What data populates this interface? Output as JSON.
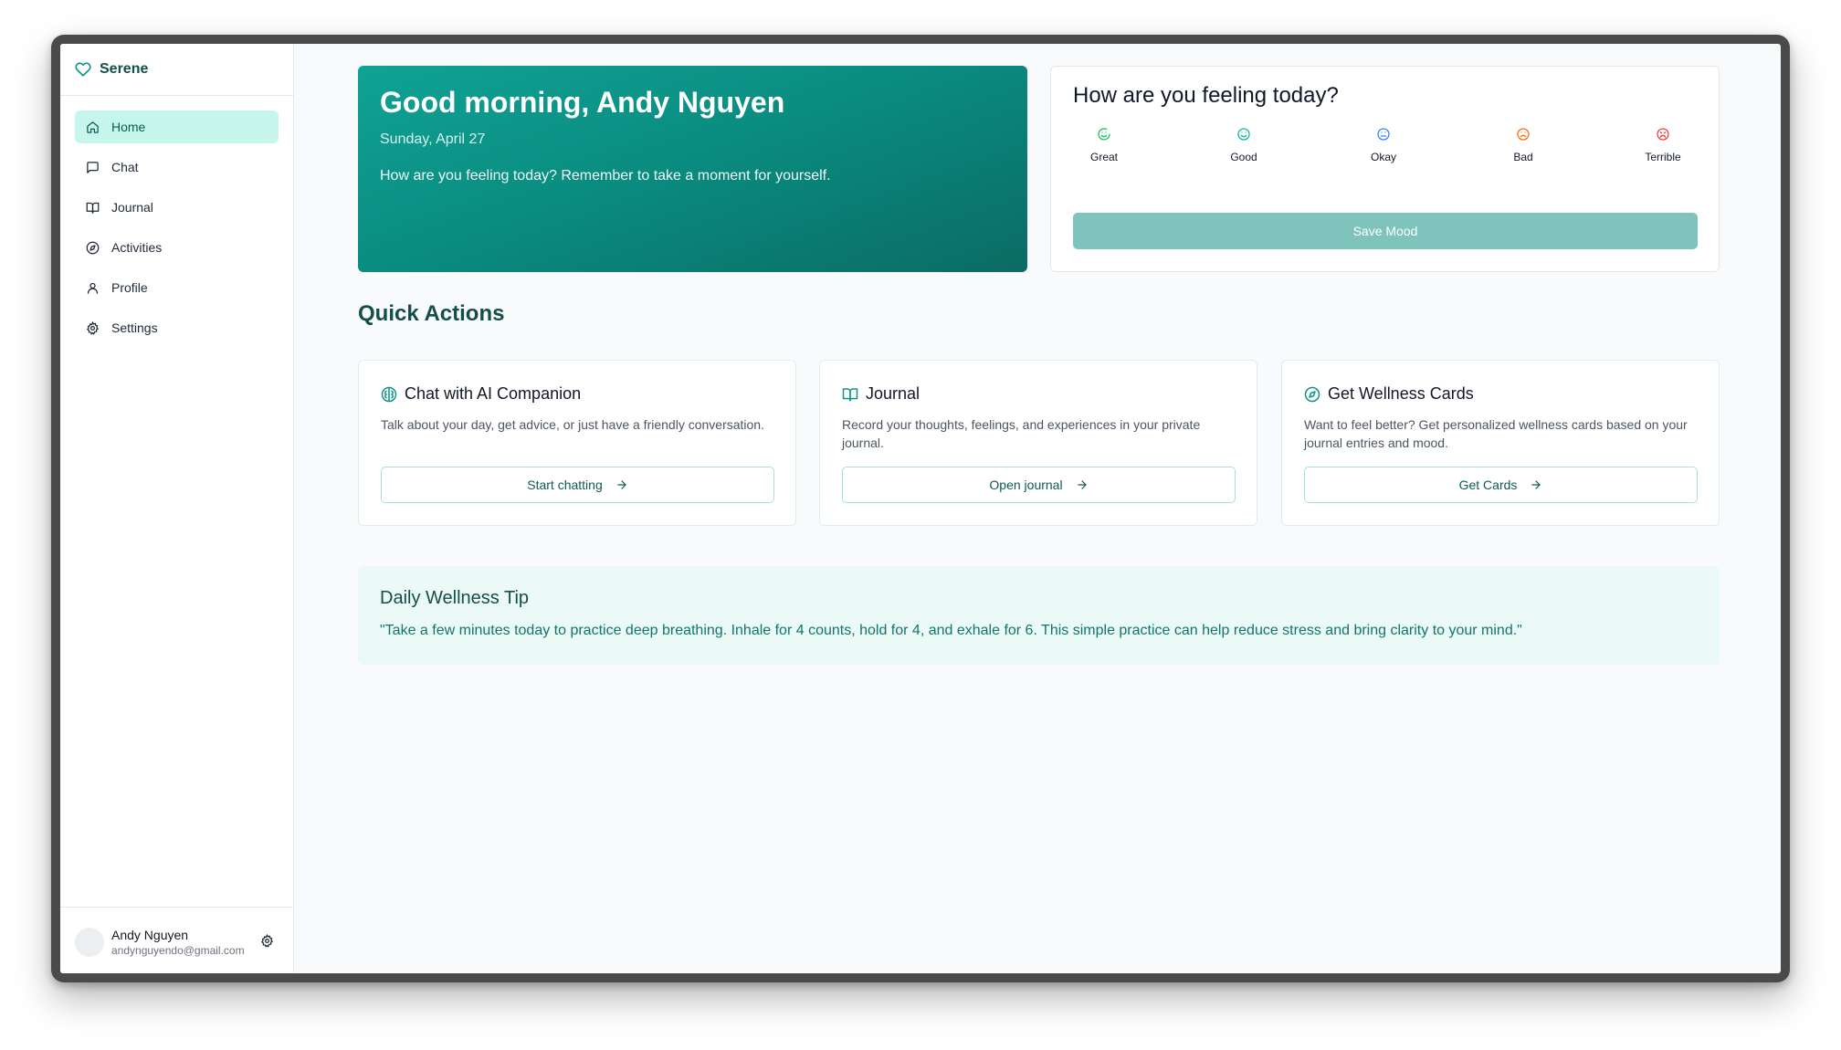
{
  "app": {
    "name": "Serene"
  },
  "sidebar": {
    "items": [
      {
        "label": "Home",
        "icon": "home-icon",
        "active": true
      },
      {
        "label": "Chat",
        "icon": "chat-icon",
        "active": false
      },
      {
        "label": "Journal",
        "icon": "book-icon",
        "active": false
      },
      {
        "label": "Activities",
        "icon": "compass-icon",
        "active": false
      },
      {
        "label": "Profile",
        "icon": "user-icon",
        "active": false
      },
      {
        "label": "Settings",
        "icon": "gear-icon",
        "active": false
      }
    ],
    "user": {
      "name": "Andy Nguyen",
      "email": "andynguyendo@gmail.com"
    }
  },
  "hero": {
    "greeting": "Good morning, Andy Nguyen",
    "date": "Sunday, April 27",
    "message": "How are you feeling today? Remember to take a moment for yourself."
  },
  "mood": {
    "title": "How are you feeling today?",
    "options": [
      {
        "label": "Great",
        "color": "#22c55e"
      },
      {
        "label": "Good",
        "color": "#14b8a6"
      },
      {
        "label": "Okay",
        "color": "#3b82f6"
      },
      {
        "label": "Bad",
        "color": "#f97316"
      },
      {
        "label": "Terrible",
        "color": "#ef4444"
      }
    ],
    "save_label": "Save Mood"
  },
  "quick_actions": {
    "title": "Quick Actions",
    "cards": [
      {
        "title": "Chat with AI Companion",
        "description": "Talk about your day, get advice, or just have a friendly conversation.",
        "button": "Start chatting",
        "icon": "brain-icon"
      },
      {
        "title": "Journal",
        "description": "Record your thoughts, feelings, and experiences in your private journal.",
        "button": "Open journal",
        "icon": "book-icon"
      },
      {
        "title": "Get Wellness Cards",
        "description": "Want to feel better? Get personalized wellness cards based on your journal entries and mood.",
        "button": "Get Cards",
        "icon": "compass-icon"
      }
    ]
  },
  "tip": {
    "title": "Daily Wellness Tip",
    "text": "\"Take a few minutes today to practice deep breathing. Inhale for 4 counts, hold for 4, and exhale for 6. This simple practice can help reduce stress and bring clarity to your mind.\""
  },
  "colors": {
    "accent": "#0f9488",
    "accent_dark": "#134e48",
    "active_bg": "#c6f6ec"
  }
}
